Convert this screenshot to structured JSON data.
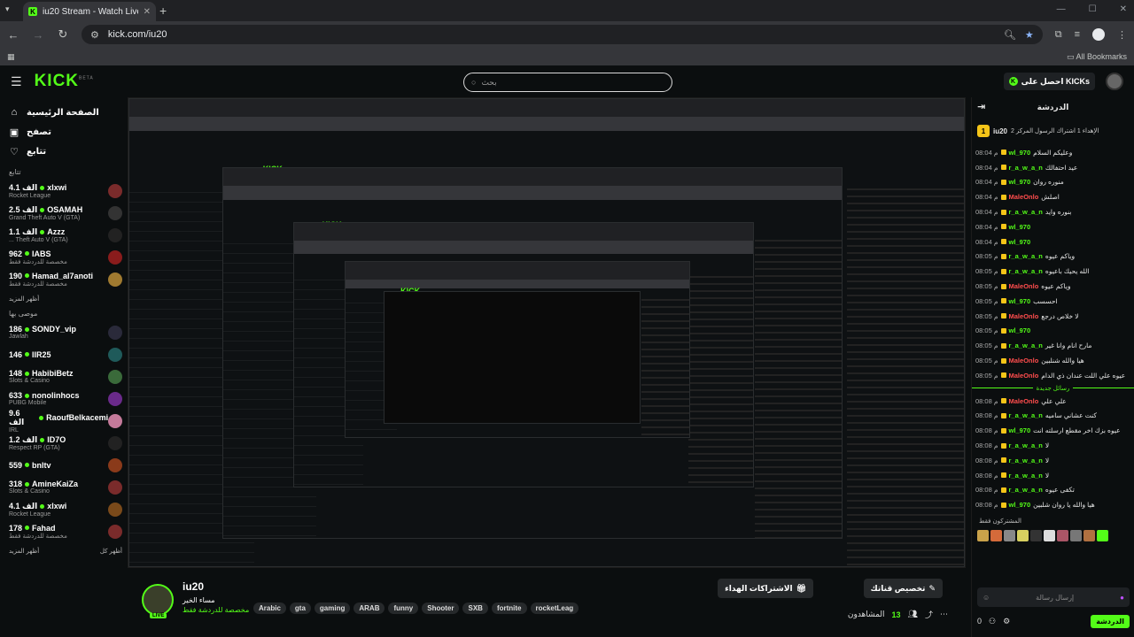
{
  "browser": {
    "tab_title": "iu20 Stream - Watch Live on Ki",
    "url": "kick.com/iu20",
    "bookmarks_label": "All Bookmarks"
  },
  "kick": {
    "search_placeholder": "بحث",
    "get_kicks": "احصل على KICKs"
  },
  "sidebar": {
    "nav": [
      {
        "label": "الصفحة الرئيسية",
        "icon": "home-icon"
      },
      {
        "label": "تصفح",
        "icon": "browse-icon"
      },
      {
        "label": "تتابع",
        "icon": "heart-icon"
      }
    ],
    "following_header": "تتابع",
    "following": [
      {
        "name": "xlxwi",
        "count": "4.1 الف",
        "sub": "Rocket League"
      },
      {
        "name": "OSAMAH",
        "count": "2.5 الف",
        "sub": "Grand Theft Auto V (GTA)"
      },
      {
        "name": "Azzz",
        "count": "1.1 الف",
        "sub": "... Theft Auto V (GTA)"
      },
      {
        "name": "IABS",
        "count": "962",
        "sub": "مخصصة للدردشة فقط"
      },
      {
        "name": "Hamad_al7anoti",
        "count": "190",
        "sub": "مخصصة للدردشة فقط"
      }
    ],
    "show_more": "أظهر المزيد",
    "recommended_header": "موصى بها",
    "recommended": [
      {
        "name": "SONDY_vip",
        "count": "186",
        "sub": "Jawlah"
      },
      {
        "name": "IIR25",
        "count": "146",
        "sub": ""
      },
      {
        "name": "HabibiBetz",
        "count": "148",
        "sub": "Slots & Casino"
      },
      {
        "name": "nonolinhocs",
        "count": "633",
        "sub": "PUBG Mobile"
      },
      {
        "name": "RaoufBelkacemi",
        "count": "9.6 الف",
        "sub": "IRL"
      },
      {
        "name": "ID7O",
        "count": "1.2 الف",
        "sub": "Respect RP (GTA)"
      },
      {
        "name": "bnltv",
        "count": "559",
        "sub": ""
      },
      {
        "name": "AmineKaiZa",
        "count": "318",
        "sub": "Slots & Casino"
      },
      {
        "name": "xlxwi",
        "count": "4.1 الف",
        "sub": "Rocket League"
      },
      {
        "name": "Fahad",
        "count": "178",
        "sub": "مخصصة للدردشة فقط"
      }
    ],
    "show_more_2": "أظهر المزيد",
    "show_all": "أظهر كل"
  },
  "stream": {
    "channel": "iu20",
    "title": "مساء الخير",
    "category": "مخصصة للدردشة فقط",
    "live_badge": "LIVE",
    "tags": [
      "Arabic",
      "gta",
      "gaming",
      "ARAB",
      "funny",
      "Shooter",
      "SXB",
      "fortnite",
      "rocketLeag"
    ],
    "btn_customize": "تخصيص قناتك",
    "btn_gift_subs": "الاشتراكات الهداء",
    "viewers_label": "المشاهدون",
    "viewers": "13"
  },
  "chat": {
    "header": "الدردشة",
    "pinned_user": "iu20",
    "pinned_num": "1",
    "pinned_text": "الإهداء 1 اشتراك الرسول المركز 2",
    "messages": [
      {
        "time": "08:04 م",
        "user": "wl_970",
        "color": "#53fc18",
        "text": "وعليكم السلام"
      },
      {
        "time": "08:04 م",
        "user": "r_a_w_a_n",
        "color": "#53fc18",
        "text": "عيد احتفالك"
      },
      {
        "time": "08:04 م",
        "user": "wl_970",
        "color": "#53fc18",
        "text": "منوره روان"
      },
      {
        "time": "08:04 م",
        "user": "MaleOnlo",
        "color": "#ff4d4d",
        "text": "اصلش"
      },
      {
        "time": "08:04 م",
        "user": "r_a_w_a_n",
        "color": "#53fc18",
        "text": "بنوره وايد"
      },
      {
        "time": "08:04 م",
        "user": "wl_970",
        "color": "#53fc18",
        "text": ""
      },
      {
        "time": "08:04 م",
        "user": "wl_970",
        "color": "#53fc18",
        "text": ""
      },
      {
        "time": "08:05 م",
        "user": "r_a_w_a_n",
        "color": "#53fc18",
        "text": "وياكم عيوه"
      },
      {
        "time": "08:05 م",
        "user": "r_a_w_a_n",
        "color": "#53fc18",
        "text": "الله يحيك باعيوه"
      },
      {
        "time": "08:05 م",
        "user": "MaleOnlo",
        "color": "#ff4d4d",
        "text": "وياكم عيوه"
      },
      {
        "time": "08:05 م",
        "user": "wl_970",
        "color": "#53fc18",
        "text": "احسسب"
      },
      {
        "time": "08:05 م",
        "user": "MaleOnlo",
        "color": "#ff4d4d",
        "text": "لا خلاص درجع"
      },
      {
        "time": "08:05 م",
        "user": "wl_970",
        "color": "#53fc18",
        "text": ""
      },
      {
        "time": "08:05 م",
        "user": "r_a_w_a_n",
        "color": "#53fc18",
        "text": "مارح انام وانا غير"
      },
      {
        "time": "08:05 م",
        "user": "MaleOnlo",
        "color": "#ff4d4d",
        "text": "هيا والله شنلبين"
      },
      {
        "time": "08:05 م",
        "user": "MaleOnlo",
        "color": "#ff4d4d",
        "text": "عيوه علي اللت عندان ذي الدام"
      }
    ],
    "new_messages": "رسائل جديدة",
    "messages2": [
      {
        "time": "08:08 م",
        "user": "MaleOnlo",
        "color": "#ff4d4d",
        "text": "علي علي"
      },
      {
        "time": "08:08 م",
        "user": "r_a_w_a_n",
        "color": "#53fc18",
        "text": "كنت عشاني ساميه"
      },
      {
        "time": "08:08 م",
        "user": "wl_970",
        "color": "#53fc18",
        "text": "عيوه بزك اخر مقطع ارسلته انت"
      },
      {
        "time": "08:08 م",
        "user": "r_a_w_a_n",
        "color": "#53fc18",
        "text": "لا"
      },
      {
        "time": "08:08 م",
        "user": "r_a_w_a_n",
        "color": "#53fc18",
        "text": "لا"
      },
      {
        "time": "08:08 م",
        "user": "r_a_w_a_n",
        "color": "#53fc18",
        "text": "لا"
      },
      {
        "time": "08:08 م",
        "user": "r_a_w_a_n",
        "color": "#53fc18",
        "text": "تكفى عيوه"
      },
      {
        "time": "08:08 م",
        "user": "wl_970",
        "color": "#53fc18",
        "text": "هيا والله يا روان شلبين"
      }
    ],
    "subs_only": "المشتركون فقط",
    "input_placeholder": "إرسال رسالة",
    "send_label": "الدردشة",
    "balance": "0"
  }
}
